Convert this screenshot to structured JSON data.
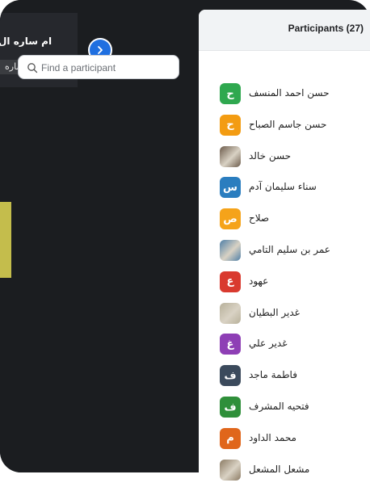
{
  "video": {
    "tile_name": "ام ساره ال",
    "name_tag": "ام ساره"
  },
  "panel": {
    "title": "Participants (27)",
    "search_placeholder": "Find a participant"
  },
  "participants": [
    {
      "name": "حسن احمد المنسف",
      "initial": "ح",
      "color": "#2fa84f",
      "photo": false
    },
    {
      "name": "حسن جاسم الصباح",
      "initial": "ح",
      "color": "#f39c12",
      "photo": false
    },
    {
      "name": "حسن خالد",
      "initial": "",
      "color": "#6b5a4a",
      "photo": true
    },
    {
      "name": "سناء سليمان آدم",
      "initial": "س",
      "color": "#2a7dbf",
      "photo": false
    },
    {
      "name": "صلاح",
      "initial": "ص",
      "color": "#f5a31a",
      "photo": false
    },
    {
      "name": "عمر بن سليم التامي",
      "initial": "",
      "color": "#4f7fa6",
      "photo": true
    },
    {
      "name": "عهود",
      "initial": "ع",
      "color": "#d93a2f",
      "photo": false
    },
    {
      "name": "غدير البطيان",
      "initial": "",
      "color": "#b7b09a",
      "photo": true
    },
    {
      "name": "غدير علي",
      "initial": "غ",
      "color": "#8e3fb5",
      "photo": false
    },
    {
      "name": "فاطمة ماجد",
      "initial": "ف",
      "color": "#3b4a5c",
      "photo": false
    },
    {
      "name": "فتحيه المشرف",
      "initial": "ف",
      "color": "#2f8f3a",
      "photo": false
    },
    {
      "name": "محمد الداود",
      "initial": "م",
      "color": "#e0661b",
      "photo": false
    },
    {
      "name": "مشعل المشعل",
      "initial": "",
      "color": "#8b7a63",
      "photo": true
    }
  ]
}
